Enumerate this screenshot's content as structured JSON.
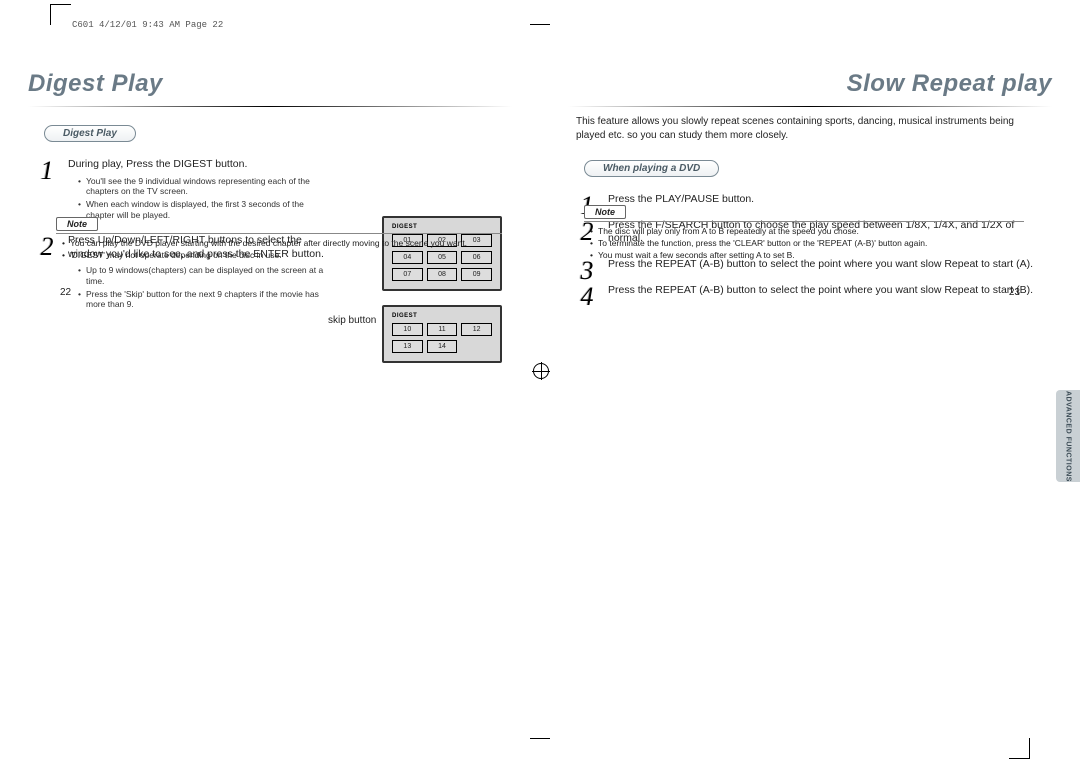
{
  "header": "C601  4/12/01 9:43 AM  Page 22",
  "left": {
    "title": "Digest Play",
    "pill": "Digest Play",
    "step1": "During play, Press the DIGEST button.",
    "step1_sub": [
      "You'll see the 9 individual windows representing each of the chapters on the TV screen.",
      "When each window is displayed, the first 3 seconds of the chapter will be played."
    ],
    "step2": "Press Up/Down/LEFT/RIGHT buttons to select the window you'd like to see, and press the ENTER button.",
    "step2_sub": [
      "Up to 9 windows(chapters) can be displayed on the screen at a time.",
      "Press the 'Skip' button for the next 9 chapters if the movie has more than 9."
    ],
    "skip_label": "skip button",
    "digest_label": "DIGEST",
    "grid1": [
      "01",
      "02",
      "03",
      "04",
      "05",
      "06",
      "07",
      "08",
      "09"
    ],
    "grid2": [
      "10",
      "11",
      "12",
      "13",
      "14"
    ],
    "note_heading": "Note",
    "notes": [
      "You can play the DVD player starting with the desired chapter after directly moving to the scene you want.",
      "'DIGEST' may not operate depending on the disc in use."
    ],
    "pagenum": "22"
  },
  "right": {
    "title": "Slow Repeat play",
    "intro": "This feature allows you slowly repeat scenes containing sports, dancing, musical instruments being played etc. so you can study them more closely.",
    "pill": "When playing a DVD",
    "step1": "Press the PLAY/PAUSE button.",
    "step2": "Press the F/SEARCH button to choose the play speed between 1/8X, 1/4X, and 1/2X of normal.",
    "step3": "Press the REPEAT (A-B) button to select the point where you want slow Repeat to start (A).",
    "step4": "Press the REPEAT (A-B) button to select the point where you want slow Repeat to start (B).",
    "note_heading": "Note",
    "notes": [
      "The disc will play only from A to B repeatedly at the speed you chose.",
      "To terminate the function, press the 'CLEAR' button or the 'REPEAT (A-B)' button again.",
      "You must wait a few seconds after setting A to set B."
    ],
    "pagenum": "23",
    "side_tab": "ADVANCED FUNCTIONS"
  }
}
